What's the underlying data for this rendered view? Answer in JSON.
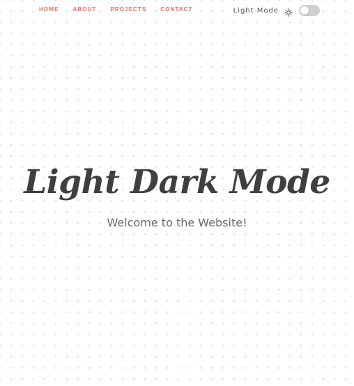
{
  "nav": {
    "items": [
      {
        "label": "HOME"
      },
      {
        "label": "ABOUT"
      },
      {
        "label": "PROJECTS"
      },
      {
        "label": "CONTACT"
      }
    ]
  },
  "mode_switch": {
    "label": "Light Mode",
    "icon": "sun-icon",
    "state": "off"
  },
  "hero": {
    "title": "Light Dark Mode",
    "subtitle": "Welcome to the Website!"
  },
  "colors": {
    "nav_link": "#ef6a6a",
    "title": "#3f3f3f",
    "subtitle": "#6b6b6b",
    "background_dots": "#c9efe4",
    "toggle_track": "#cfcfcf"
  }
}
